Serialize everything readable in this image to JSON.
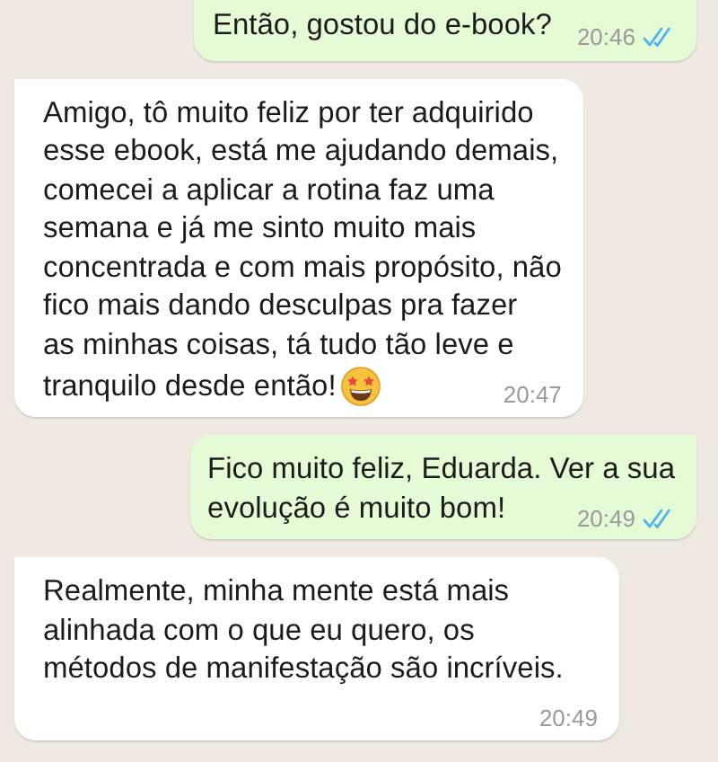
{
  "messages": [
    {
      "kind": "outgoing",
      "lines": [
        "Então, gostou do e-book?"
      ],
      "time": "20:46",
      "read": true
    },
    {
      "kind": "incoming",
      "lines": [
        "Amigo, tô muito feliz por ter adquirido",
        "esse ebook, está me ajudando demais,",
        "comecei a aplicar a rotina faz uma",
        "semana e já me sinto muito mais",
        "concentrada e com mais propósito, não",
        "fico mais dando desculpas pra fazer",
        "as minhas coisas, tá tudo tão leve e",
        "tranquilo desde então!"
      ],
      "emoji": true,
      "time": "20:47"
    },
    {
      "kind": "outgoing",
      "lines": [
        "Fico muito feliz, Eduarda. Ver a sua",
        "evolução é muito bom!"
      ],
      "time": "20:49",
      "read": true
    },
    {
      "kind": "incoming",
      "lines": [
        "Realmente, minha mente está mais",
        "alinhada com o que eu quero, os",
        "métodos de manifestação são incríveis."
      ],
      "time": "20:49"
    }
  ]
}
